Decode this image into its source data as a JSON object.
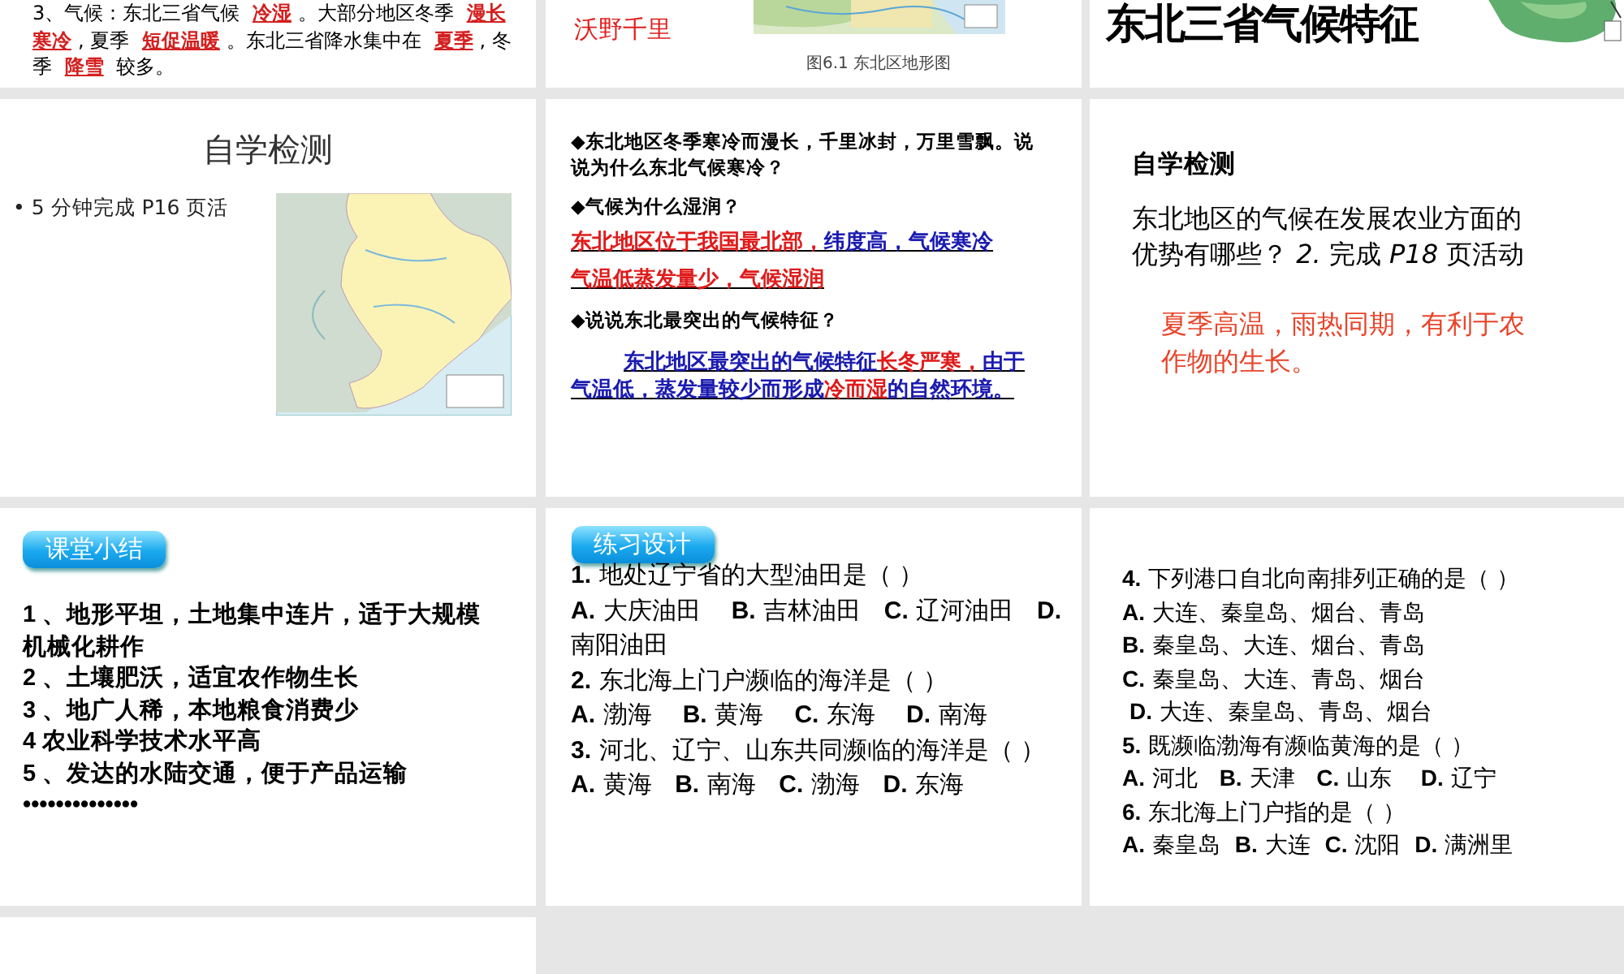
{
  "slides": [
    {
      "kind": "notes",
      "blocks": [
        {
          "kind": "mixed",
          "segments": [
            {
              "text": "3、气候：东北三省气候 "
            },
            {
              "kind": "blank",
              "text": "冷湿",
              "color": "#d42020"
            },
            {
              "text": "。大部分地区冬季 "
            },
            {
              "kind": "blank",
              "text": "漫长寒冷",
              "color": "#d42020"
            },
            {
              "text": ", 夏季 "
            },
            {
              "kind": "blank",
              "text": "短促温暖",
              "color": "#d42020"
            },
            {
              "text": "。东北三省降水集中在 "
            },
            {
              "kind": "blank",
              "text": "夏季",
              "color": "#d42020"
            },
            {
              "text": ", 冬季 "
            },
            {
              "kind": "blank",
              "text": "降雪",
              "color": "#d42020"
            },
            {
              "text": " 较多。"
            }
          ]
        }
      ]
    },
    {
      "kind": "title_map",
      "blocks": [
        {
          "kind": "red_heading",
          "text": "沃野千里"
        },
        {
          "kind": "picture"
        },
        {
          "kind": "caption",
          "text": "图6.1 东北区地形图"
        }
      ]
    },
    {
      "kind": "title_banner",
      "blocks": [
        {
          "kind": "big_title",
          "text": "东北三省气候特征"
        },
        {
          "kind": "picture"
        }
      ]
    },
    {
      "kind": "check_map",
      "blocks": [
        {
          "kind": "heading",
          "text": "自学检测"
        },
        {
          "kind": "bullet",
          "text": "• 5 分钟完成 P16 页活"
        },
        {
          "kind": "picture"
        }
      ]
    },
    {
      "kind": "questions",
      "blocks": [
        {
          "kind": "question",
          "text": "◆东北地区冬季寒冷而漫长，千里冰封，万里雪飘。说说为什么东北气候寒冷？"
        },
        {
          "kind": "question",
          "text": "◆气候为什么湿润？"
        },
        {
          "kind": "answer",
          "segments": [
            {
              "text": "东北地区位于我国最北部，",
              "color": "#e01b1b"
            },
            {
              "text": "纬度高，气候寒冷",
              "color": "#1b1bb0"
            }
          ]
        },
        {
          "kind": "answer",
          "segments": [
            {
              "text": "气温低蒸发量少，气候湿润",
              "color": "#e01b1b"
            }
          ]
        },
        {
          "kind": "question",
          "text": "◆说说东北最突出的气候特征？"
        },
        {
          "kind": "answer",
          "segments": [
            {
              "text": "东北地区最突出的气候特征",
              "color": "#1b1bb0"
            },
            {
              "text": "长冬严寒，",
              "color": "#e01b1b"
            },
            {
              "text": "由于气温低，蒸发量较少而形成",
              "color": "#1b1bb0"
            },
            {
              "text": "冷而湿",
              "color": "#e01b1b"
            },
            {
              "text": "的自然环境。",
              "color": "#1b1bb0"
            }
          ]
        }
      ]
    },
    {
      "kind": "check",
      "blocks": [
        {
          "kind": "heading",
          "text": "自学检测"
        },
        {
          "kind": "plain",
          "text": "东北地区的气候在发展农业方面的优势有哪些？ *2.* 完成 *P18* 页活动"
        },
        {
          "kind": "answer_text",
          "text": "夏季高温，雨热同期，有利于农作物的生长。"
        }
      ]
    },
    {
      "kind": "summary",
      "blocks": [
        {
          "kind": "tag",
          "text": "课堂小结"
        },
        {
          "kind": "item",
          "text": "1 、地形平坦，土地集中连片，适于大规模机械化耕作"
        },
        {
          "kind": "item",
          "text": "2 、土壤肥沃，适宜农作物生长"
        },
        {
          "kind": "item",
          "text": "3 、地广人稀，本地粮食消费少"
        },
        {
          "kind": "item",
          "text": "4 农业科学技术水平高"
        },
        {
          "kind": "item",
          "text": "5 、发达的水陆交通，便于产品运输"
        },
        {
          "kind": "item",
          "text": "••••••••••••••"
        }
      ]
    },
    {
      "kind": "exercise",
      "blocks": [
        {
          "kind": "tag",
          "text": "练习设计"
        },
        {
          "kind": "option",
          "text": "**1.** 地处辽宁省的大型油田是（ ）"
        },
        {
          "kind": "option",
          "text": "**A.** 大庆油田    **B.** 吉林油田   **C.** 辽河油田   **D.** 南阳油田"
        },
        {
          "kind": "option",
          "text": "**2.** 东北海上门户濒临的海洋是（ ）"
        },
        {
          "kind": "option",
          "text": "**A.** 渤海    **B.** 黄海    **C.** 东海    **D.** 南海"
        },
        {
          "kind": "option",
          "text": "**3.** 河北、辽宁、山东共同濒临的海洋是（ ）"
        },
        {
          "kind": "option",
          "text": "**A.** 黄海   **B.** 南海   **C.** 渤海   **D.** 东海"
        }
      ]
    },
    {
      "kind": "exercise_cont",
      "blocks": [
        {
          "kind": "option",
          "text": "**4.** 下列港口自北向南排列正确的是（ ）"
        },
        {
          "kind": "option",
          "text": "**A.** 大连、秦皇岛、烟台、青岛"
        },
        {
          "kind": "option",
          "text": "**B.** 秦皇岛、大连、烟台、青岛"
        },
        {
          "kind": "option",
          "text": "**C.** 秦皇岛、大连、青岛、烟台"
        },
        {
          "kind": "option",
          "text": " **D.** 大连、秦皇岛、青岛、烟台"
        },
        {
          "kind": "option",
          "text": "**5.** 既濒临渤海有濒临黄海的是（ ）"
        },
        {
          "kind": "option",
          "text": "**A.** 河北   **B.** 天津   **C.** 山东    **D.** 辽宁"
        },
        {
          "kind": "option",
          "text": "**6.** 东北海上门户指的是（ ）"
        },
        {
          "kind": "option",
          "text": "**A.** 秦皇岛  **B.** 大连  **C.** 沈阳  **D.** 满洲里"
        }
      ]
    },
    {
      "kind": "blank"
    }
  ]
}
